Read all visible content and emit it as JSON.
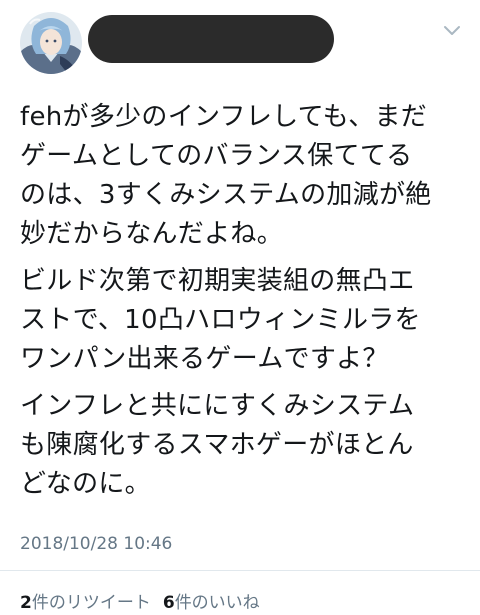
{
  "tweet": {
    "paragraphs": [
      "fehが多少のインフレしても、まだ\nゲームとしてのバランス保ててる\nのは、3すくみシステムの加減が絶\n妙だからなんだよね。",
      "ビルド次第で初期実装組の無凸エ\nストで、10凸ハロウィンミルラを\nワンパン出来るゲームですよ？",
      "インフレと共ににすくみシステム\nも陳腐化するスマホゲーがほとん\nどなのに。"
    ],
    "timestamp": "2018/10/28 10:46",
    "stats": {
      "retweets_count": "2",
      "retweets_label": "件のリツイート",
      "likes_count": "6",
      "likes_label": "件のいいね"
    }
  },
  "icons": {
    "menu": "chevron-down-icon",
    "avatar": "avatar"
  },
  "colors": {
    "text": "#14171a",
    "muted": "#657786",
    "divider": "#e1e8ed",
    "redaction": "#2b2b2b"
  }
}
